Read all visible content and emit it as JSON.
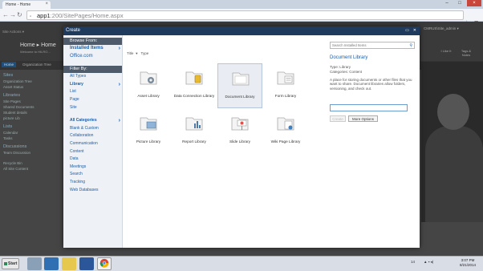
{
  "browser": {
    "tab_title": "Home - Home",
    "url_host": "app1",
    "url_path": ":200/SitePages/Home.aspx"
  },
  "sharepoint": {
    "site_actions": "Site Actions ▾",
    "site_title": "Home ▸ Home",
    "welcome": "Welcome to HILRO...",
    "user": "CMRUS\\Site_admin ▾",
    "like_it": "I Like It",
    "tags_notes": "Tags & Notes",
    "home_tab": "Home",
    "org_tab": "Organization Tree",
    "leftnav": {
      "sites_h": "Sites",
      "org_tree": "Organization Tree",
      "asset_status": "Asset Status",
      "libraries_h": "Libraries",
      "site_pages": "Site Pages",
      "shared_docs": "Shared Documents",
      "student_details": "Student details",
      "picture_lib": "picture Lib",
      "lists_h": "Lists",
      "calendar": "Calendar",
      "tasks": "Tasks",
      "discussions_h": "Discussions",
      "team_discussion": "Team Discussion",
      "recycle_bin": "Recycle Bin",
      "all_site_content": "All Site Content"
    }
  },
  "dialog": {
    "title": "Create",
    "browse_from": "Browse From:",
    "installed_items": "Installed Items",
    "office_com": "Office.com",
    "filter_by": "Filter By:",
    "all_types": "All Types",
    "library": "Library",
    "list": "List",
    "page": "Page",
    "site": "Site",
    "all_categories": "All Categories",
    "categories": [
      "Blank & Custom",
      "Collaboration",
      "Communication",
      "Content",
      "Data",
      "Meetings",
      "Search",
      "Tracking",
      "Web Databases"
    ],
    "sort_title": "Title",
    "sort_type": "Type",
    "tiles": [
      {
        "label": "Asset Library"
      },
      {
        "label": "Data Connection Library"
      },
      {
        "label": "Document Library"
      },
      {
        "label": "Form Library"
      },
      {
        "label": "Picture Library"
      },
      {
        "label": "Report Library"
      },
      {
        "label": "Slide Library"
      },
      {
        "label": "Wiki Page Library"
      }
    ],
    "search_placeholder": "Search Installed Items",
    "detail_title": "Document Library",
    "detail_type": "Type: Library",
    "detail_categories": "Categories: Content",
    "detail_desc": "A place for storing documents or other files that you want to share. Document libraries allow folders, versioning, and check out.",
    "name_value": "",
    "create_btn": "Create",
    "more_options_btn": "More Options"
  },
  "taskbar": {
    "start": "Start",
    "tray_num": "14",
    "time": "3:07 PM",
    "date": "8/21/2014"
  }
}
